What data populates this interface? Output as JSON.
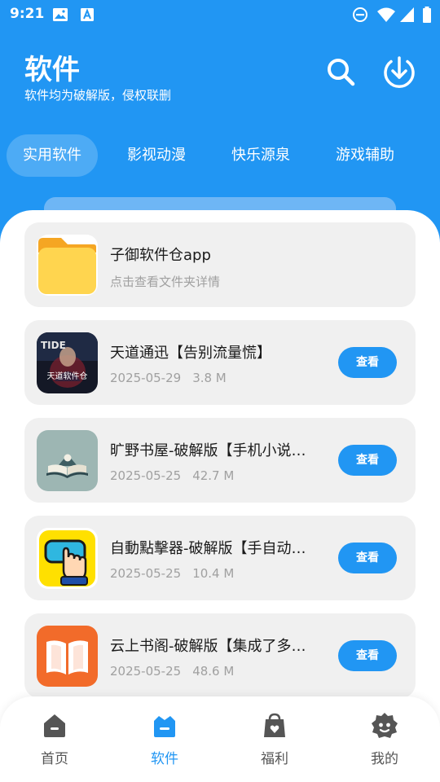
{
  "status_bar": {
    "time": "9:21"
  },
  "header": {
    "title": "软件",
    "subtitle": "软件均为破解版，侵权联删"
  },
  "tabs": [
    {
      "label": "实用软件",
      "active": true
    },
    {
      "label": "影视动漫",
      "active": false
    },
    {
      "label": "快乐源泉",
      "active": false
    },
    {
      "label": "游戏辅助",
      "active": false
    }
  ],
  "folder_card": {
    "title": "子御软件仓app",
    "subtitle": "点击查看文件夹详情",
    "icon": "folder-icon"
  },
  "apps": [
    {
      "title": "天道通迅【告别流量慌】",
      "date": "2025-05-29",
      "size": "3.8 M",
      "button": "查看",
      "icon_text": "天道软件仓"
    },
    {
      "title": "旷野书屋-破解版【手机小说…",
      "date": "2025-05-25",
      "size": "42.7 M",
      "button": "查看",
      "icon": "open-book-icon"
    },
    {
      "title": "自動點擊器-破解版【手自动…",
      "date": "2025-05-25",
      "size": "10.4 M",
      "button": "查看",
      "icon": "tap-hand-icon"
    },
    {
      "title": "云上书阁-破解版【集成了多…",
      "date": "2025-05-25",
      "size": "48.6 M",
      "button": "查看",
      "icon": "book-icon"
    }
  ],
  "bottom_nav": [
    {
      "label": "首页",
      "icon": "home-icon",
      "active": false
    },
    {
      "label": "软件",
      "icon": "software-icon",
      "active": true
    },
    {
      "label": "福利",
      "icon": "gift-bag-icon",
      "active": false
    },
    {
      "label": "我的",
      "icon": "profile-icon",
      "active": false
    }
  ],
  "colors": {
    "primary": "#2196F3",
    "card_bg": "#F0F0F0",
    "meta_text": "#A0A0A0"
  }
}
